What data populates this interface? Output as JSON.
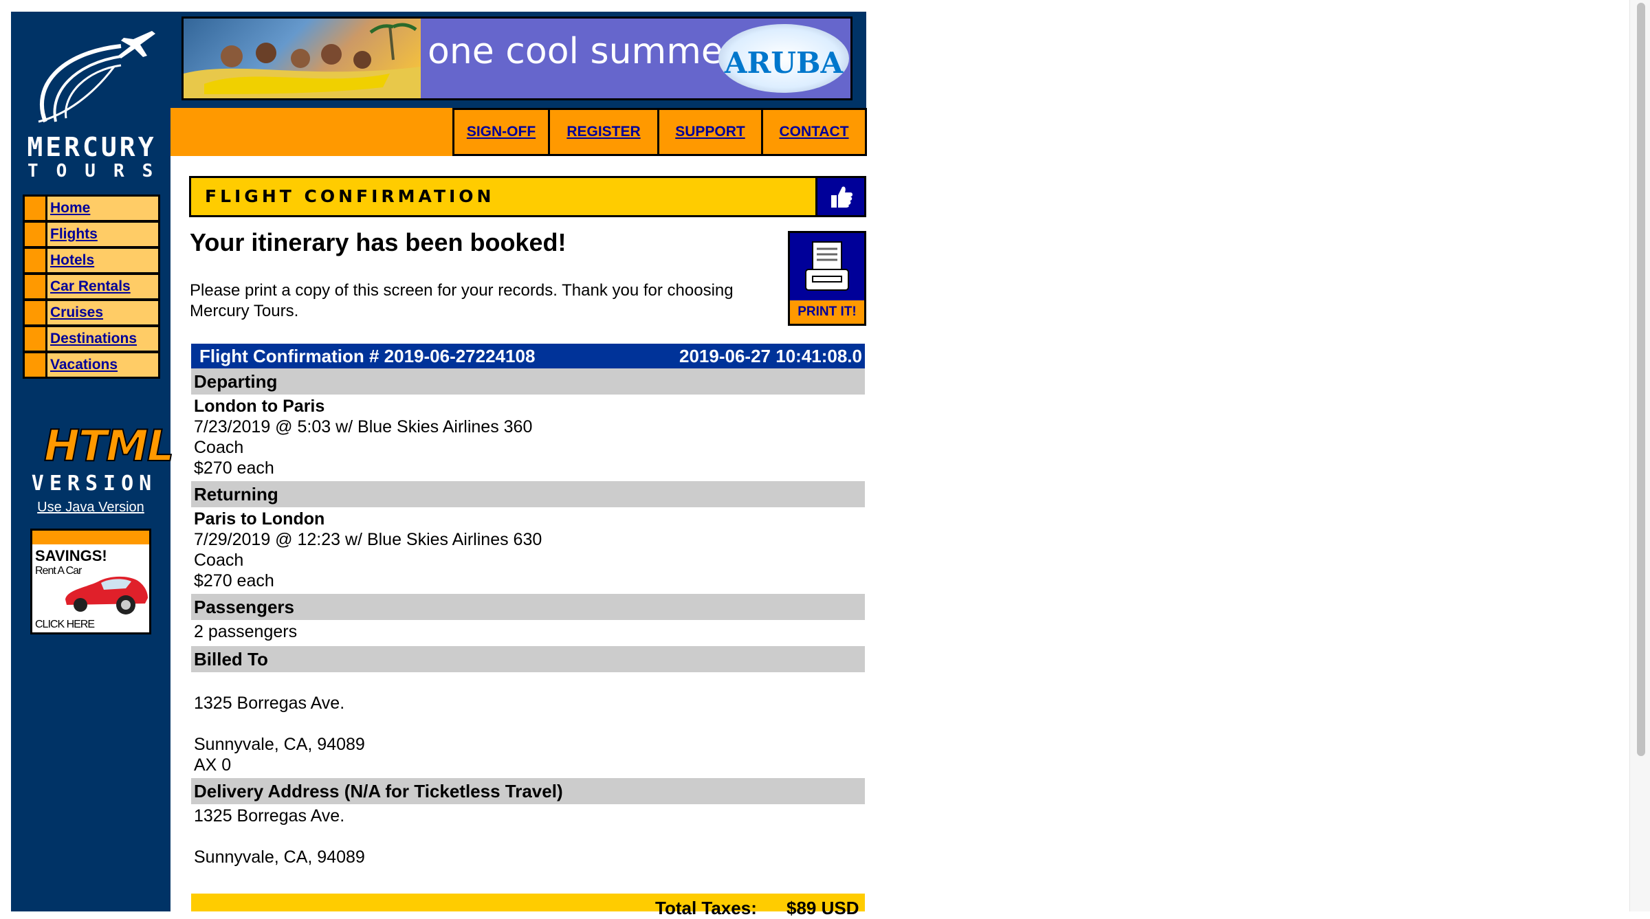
{
  "brand": {
    "name": "MERCURY",
    "subtitle": "TOURS"
  },
  "sidebar": {
    "items": [
      {
        "label": "Home"
      },
      {
        "label": "Flights"
      },
      {
        "label": "Hotels"
      },
      {
        "label": "Car Rentals"
      },
      {
        "label": "Cruises"
      },
      {
        "label": "Destinations"
      },
      {
        "label": "Vacations"
      }
    ],
    "html_version": {
      "big": "HTML",
      "small": "VERSION"
    },
    "java_link": "Use Java Version",
    "ad": {
      "title": "SAVINGS!",
      "subtitle": "Rent A Car",
      "cta": "CLICK HERE"
    }
  },
  "banner": {
    "tagline": "one cool summer",
    "badge": "ARUBA"
  },
  "topnav": {
    "items": [
      {
        "label": "SIGN-OFF"
      },
      {
        "label": "REGISTER"
      },
      {
        "label": "SUPPORT"
      },
      {
        "label": "CONTACT"
      }
    ]
  },
  "page": {
    "title": "FLIGHT CONFIRMATION",
    "heading": "Your itinerary has been booked!",
    "message": "Please print a copy of this screen for your records. Thank you for choosing Mercury Tours.",
    "print_label": "PRINT IT!"
  },
  "confirmation": {
    "number_label": "Flight Confirmation # 2019-06-27224108",
    "timestamp": "2019-06-27 10:41:08.0",
    "departing": {
      "header": "Departing",
      "route": "London to Paris",
      "details": "7/23/2019 @ 5:03 w/ Blue Skies Airlines 360",
      "class": "Coach",
      "price": "$270 each"
    },
    "returning": {
      "header": "Returning",
      "route": "Paris to London",
      "details": "7/29/2019 @ 12:23 w/ Blue Skies Airlines 630",
      "class": "Coach",
      "price": "$270 each"
    },
    "passengers": {
      "header": "Passengers",
      "value": "2 passengers"
    },
    "billed_to": {
      "header": "Billed To",
      "address1": "1325 Borregas Ave.",
      "address2": "Sunnyvale, CA, 94089",
      "card": "AX 0"
    },
    "delivery": {
      "header": "Delivery Address (N/A for Ticketless Travel)",
      "address1": "1325 Borregas Ave.",
      "address2": "Sunnyvale, CA, 94089"
    },
    "total_taxes": {
      "label": "Total Taxes:",
      "value": "$89 USD"
    }
  },
  "colors": {
    "sidebar_bg": "#003366",
    "accent_orange": "#ff9900",
    "title_yellow": "#ffcc00",
    "header_blue": "#003399",
    "link": "#000099",
    "section_gray": "#cccccc"
  }
}
